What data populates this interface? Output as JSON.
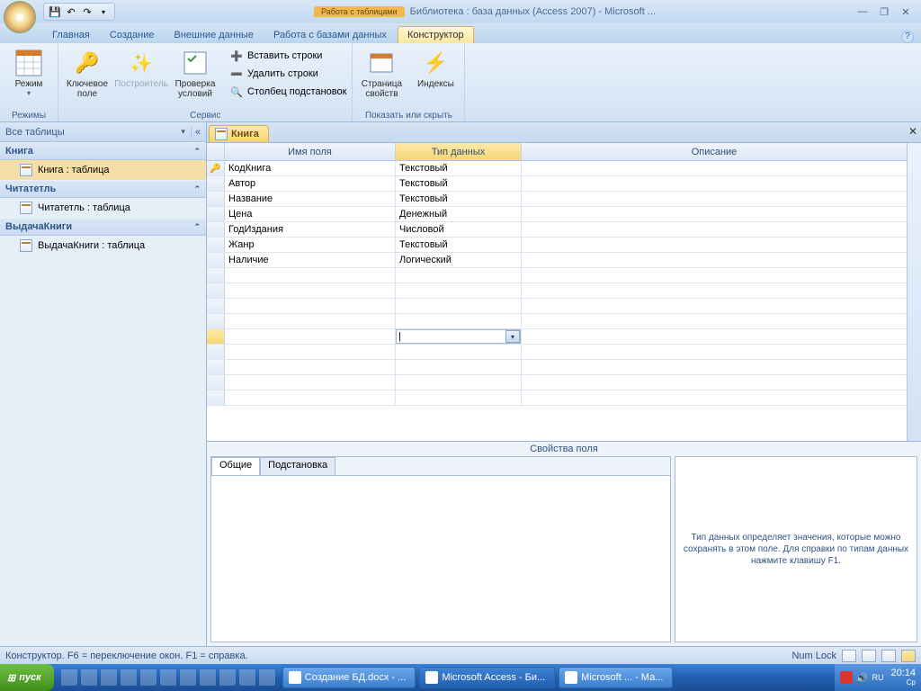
{
  "titlebar": {
    "context_group": "Работа с таблицами",
    "context_tab": "Конструктор",
    "app_title": "Библиотека : база данных (Access 2007) - Microsoft ..."
  },
  "ribbon_tabs": [
    "Главная",
    "Создание",
    "Внешние данные",
    "Работа с базами данных",
    "Конструктор"
  ],
  "ribbon": {
    "group1": {
      "title": "Режимы",
      "mode": "Режим"
    },
    "group2": {
      "title": "Сервис",
      "key": "Ключевое поле",
      "builder": "Построитель",
      "check": "Проверка условий",
      "insrow": "Вставить строки",
      "delrow": "Удалить строки",
      "lookup": "Столбец подстановок"
    },
    "group3": {
      "title": "Показать или скрыть",
      "props": "Страница свойств",
      "idx": "Индексы"
    }
  },
  "nav": {
    "header": "Все таблицы",
    "groups": [
      {
        "title": "Книга",
        "items": [
          {
            "label": "Книга : таблица",
            "selected": true
          }
        ]
      },
      {
        "title": "Читатетль",
        "items": [
          {
            "label": "Читатетль : таблица",
            "selected": false
          }
        ]
      },
      {
        "title": "ВыдачаКниги",
        "items": [
          {
            "label": "ВыдачаКниги : таблица",
            "selected": false
          }
        ]
      }
    ]
  },
  "doc_tab": "Книга",
  "grid": {
    "headers": {
      "name": "Имя поля",
      "type": "Тип данных",
      "desc": "Описание"
    },
    "rows": [
      {
        "key": true,
        "name": "КодКнига",
        "type": "Текстовый"
      },
      {
        "key": false,
        "name": "Автор",
        "type": "Текстовый"
      },
      {
        "key": false,
        "name": "Название",
        "type": "Текстовый"
      },
      {
        "key": false,
        "name": "Цена",
        "type": "Денежный"
      },
      {
        "key": false,
        "name": "ГодИздания",
        "type": "Числовой"
      },
      {
        "key": false,
        "name": "Жанр",
        "type": "Текстовый"
      },
      {
        "key": false,
        "name": "Наличие",
        "type": "Логический"
      }
    ]
  },
  "prop": {
    "title": "Свойства поля",
    "tab_general": "Общие",
    "tab_lookup": "Подстановка",
    "help": "Тип данных определяет значения, которые можно сохранять в этом поле.  Для справки по типам данных нажмите клавишу F1."
  },
  "status": {
    "left": "Конструктор.  F6 = переключение окон.  F1 = справка.",
    "numlock": "Num Lock"
  },
  "taskbar": {
    "start": "пуск",
    "tasks": [
      {
        "label": "Создание БД.docx - ..."
      },
      {
        "label": "Microsoft Access - Би..."
      },
      {
        "label": "Microsoft ... - Ма..."
      }
    ],
    "time": "20:14",
    "day": "Ср"
  }
}
